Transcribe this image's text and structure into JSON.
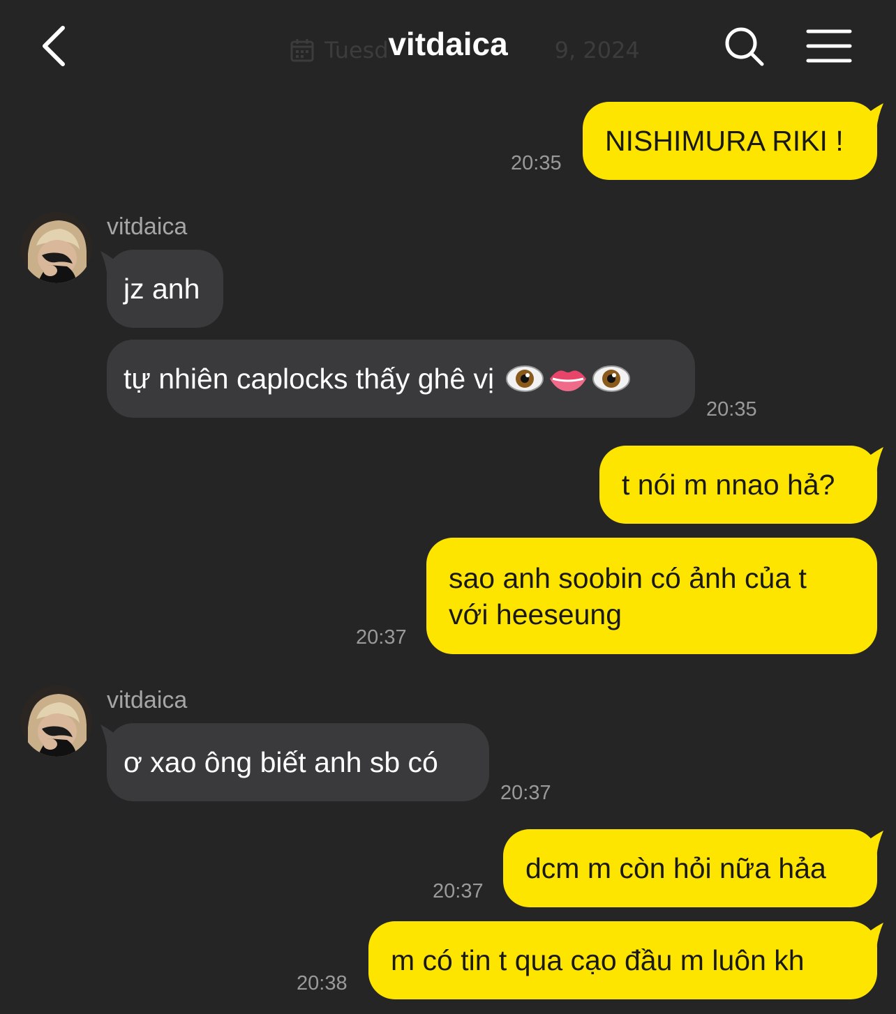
{
  "header": {
    "title": "vitdaica",
    "date_left": "Tuesd",
    "date_right": "9, 2024"
  },
  "messages": [
    {
      "id": "m1",
      "direction": "out",
      "text": "NISHIMURA RIKI !",
      "time": "20:35"
    },
    {
      "id": "m2",
      "direction": "in",
      "sender": "vitdaica",
      "text": "jz anh",
      "time": ""
    },
    {
      "id": "m3",
      "direction": "in",
      "text": "tự nhiên caplocks thấy ghê vị",
      "emoji": [
        "eye-icon",
        "lips-icon",
        "eye-icon"
      ],
      "time": "20:35"
    },
    {
      "id": "m4",
      "direction": "out",
      "text": "t nói m nnao hả?",
      "time": ""
    },
    {
      "id": "m5",
      "direction": "out",
      "lines": [
        "sao anh soobin có ảnh của t",
        "với heeseung"
      ],
      "time": "20:37"
    },
    {
      "id": "m6",
      "direction": "in",
      "sender": "vitdaica",
      "text": "ơ xao ông biết anh sb có",
      "time": "20:37"
    },
    {
      "id": "m7",
      "direction": "out",
      "text": "dcm m còn hỏi nữa hảa",
      "time": "20:37"
    },
    {
      "id": "m8",
      "direction": "out",
      "text": "m có tin t qua cạo đầu m luôn kh",
      "time": "20:38"
    }
  ],
  "colors": {
    "background": "#252526",
    "outgoing_bubble": "#fee500",
    "incoming_bubble": "#3a3a3c",
    "timestamp": "#9a9a9a"
  }
}
